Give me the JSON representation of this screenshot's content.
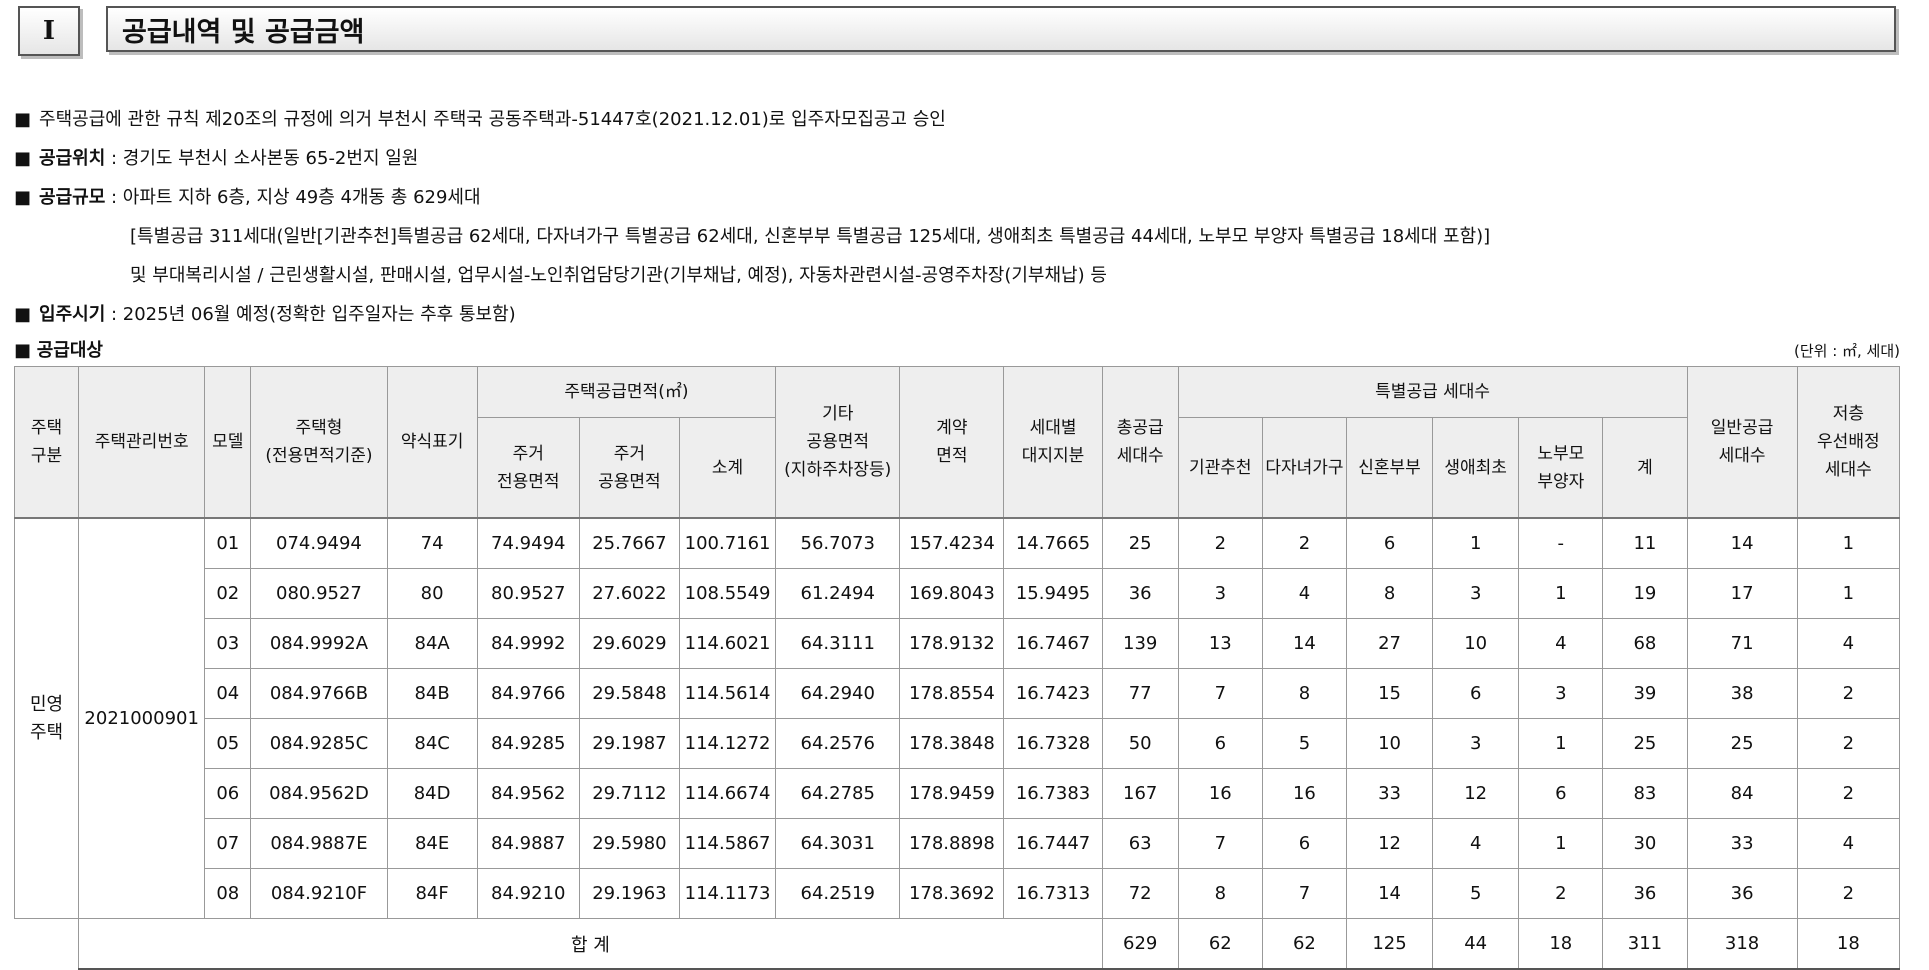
{
  "section": {
    "number": "I",
    "title": "공급내역 및 공급금액"
  },
  "info": {
    "bullet": "■",
    "approval": "주택공급에 관한 규칙 제20조의 규정에 의거 부천시 주택국 공동주택과-51447호(2021.12.01)로 입주자모집공고 승인",
    "location_label": "공급위치",
    "location_value": " : 경기도 부천시 소사본동 65-2번지 일원",
    "scale_label": "공급규모",
    "scale_value": " : 아파트 지하 6층, 지상 49층 4개동 총 629세대",
    "scale_detail": "[특별공급 311세대(일반[기관추천]특별공급 62세대, 다자녀가구 특별공급 62세대, 신혼부부 특별공급 125세대, 생애최초 특별공급 44세대, 노부모 부양자 특별공급 18세대 포함)]",
    "scale_facilities": " 및 부대복리시설 / 근린생활시설, 판매시설, 업무시설-노인취업담당기관(기부채납, 예정), 자동차관련시설-공영주차장(기부채납) 등",
    "movein_label": "입주시기",
    "movein_value": " : 2025년 06월 예정(정확한 입주일자는 추후 통보함)",
    "target_label": "공급대상",
    "unit_note": "(단위 : ㎡, 세대)"
  },
  "table": {
    "headers": {
      "house_type_group": "주택\n구분",
      "mgmt_no": "주택관리번호",
      "model": "모델",
      "housing_type": "주택형\n(전용면적기준)",
      "abbr": "약식표기",
      "supply_area": "주택공급면적(㎡)",
      "exclusive": "주거\n전용면적",
      "common": "주거\n공용면적",
      "subtotal": "소계",
      "other_common": "기타\n공용면적\n(지하주차장등)",
      "contract_area": "계약\n면적",
      "land_share": "세대별\n대지지분",
      "total_units": "총공급\n세대수",
      "special": "특별공급 세대수",
      "institution": "기관추천",
      "multichild": "다자녀가구",
      "newlywed": "신혼부부",
      "firsttime": "생애최초",
      "elderly": "노부모\n부양자",
      "special_sum": "계",
      "general": "일반공급\n세대수",
      "low_floor": "저층\n우선배정\n세대수"
    },
    "group_label": "민영\n주택",
    "mgmt_no": "2021000901",
    "rows": [
      [
        "01",
        "074.9494",
        "74",
        "74.9494",
        "25.7667",
        "100.7161",
        "56.7073",
        "157.4234",
        "14.7665",
        "25",
        "2",
        "2",
        "6",
        "1",
        "-",
        "11",
        "14",
        "1"
      ],
      [
        "02",
        "080.9527",
        "80",
        "80.9527",
        "27.6022",
        "108.5549",
        "61.2494",
        "169.8043",
        "15.9495",
        "36",
        "3",
        "4",
        "8",
        "3",
        "1",
        "19",
        "17",
        "1"
      ],
      [
        "03",
        "084.9992A",
        "84A",
        "84.9992",
        "29.6029",
        "114.6021",
        "64.3111",
        "178.9132",
        "16.7467",
        "139",
        "13",
        "14",
        "27",
        "10",
        "4",
        "68",
        "71",
        "4"
      ],
      [
        "04",
        "084.9766B",
        "84B",
        "84.9766",
        "29.5848",
        "114.5614",
        "64.2940",
        "178.8554",
        "16.7423",
        "77",
        "7",
        "8",
        "15",
        "6",
        "3",
        "39",
        "38",
        "2"
      ],
      [
        "05",
        "084.9285C",
        "84C",
        "84.9285",
        "29.1987",
        "114.1272",
        "64.2576",
        "178.3848",
        "16.7328",
        "50",
        "6",
        "5",
        "10",
        "3",
        "1",
        "25",
        "25",
        "2"
      ],
      [
        "06",
        "084.9562D",
        "84D",
        "84.9562",
        "29.7112",
        "114.6674",
        "64.2785",
        "178.9459",
        "16.7383",
        "167",
        "16",
        "16",
        "33",
        "12",
        "6",
        "83",
        "84",
        "2"
      ],
      [
        "07",
        "084.9887E",
        "84E",
        "84.9887",
        "29.5980",
        "114.5867",
        "64.3031",
        "178.8898",
        "16.7447",
        "63",
        "7",
        "6",
        "12",
        "4",
        "1",
        "30",
        "33",
        "4"
      ],
      [
        "08",
        "084.9210F",
        "84F",
        "84.9210",
        "29.1963",
        "114.1173",
        "64.2519",
        "178.3692",
        "16.7313",
        "72",
        "8",
        "7",
        "14",
        "5",
        "2",
        "36",
        "36",
        "2"
      ]
    ],
    "total": {
      "label": "합 계",
      "values": [
        "629",
        "62",
        "62",
        "125",
        "44",
        "18",
        "311",
        "318",
        "18"
      ]
    }
  }
}
